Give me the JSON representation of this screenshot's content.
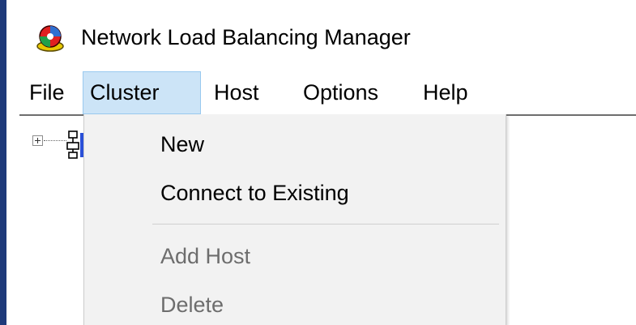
{
  "window": {
    "title": "Network Load Balancing Manager",
    "icon": "network-load-balancing-icon"
  },
  "menubar": {
    "items": [
      {
        "label": "File"
      },
      {
        "label": "Cluster",
        "active": true
      },
      {
        "label": "Host"
      },
      {
        "label": "Options"
      },
      {
        "label": "Help"
      }
    ]
  },
  "cluster_menu": {
    "items": [
      {
        "label": "New",
        "enabled": true
      },
      {
        "label": "Connect to Existing",
        "enabled": true
      },
      {
        "label": "Add Host",
        "enabled": false
      },
      {
        "label": "Delete",
        "enabled": false
      }
    ]
  },
  "tree": {
    "root_icon": "cluster-tree-icon",
    "expander": "plus"
  },
  "colors": {
    "window_border": "#1e3a7a",
    "menu_highlight": "#cce4f7",
    "menu_highlight_border": "#99c9ef",
    "dropdown_bg": "#f2f2f2",
    "disabled_text": "#6d6d6d"
  }
}
